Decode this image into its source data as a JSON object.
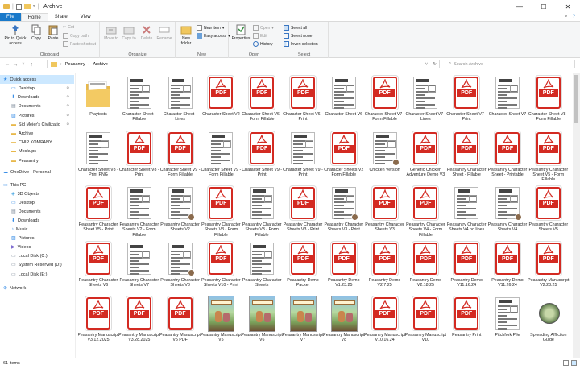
{
  "window": {
    "title": "Archive",
    "controls": {
      "minimize": "—",
      "maximize": "☐",
      "close": "✕"
    }
  },
  "tabs": [
    {
      "label": "File",
      "kind": "file"
    },
    {
      "label": "Home",
      "kind": "active"
    },
    {
      "label": "Share",
      "kind": ""
    },
    {
      "label": "View",
      "kind": ""
    }
  ],
  "ribbon": {
    "clipboard": {
      "label": "Clipboard",
      "pin": "Pin to Quick access",
      "copy": "Copy",
      "paste": "Paste",
      "cut": "Cut",
      "copy_path": "Copy path",
      "paste_shortcut": "Paste shortcut"
    },
    "organize": {
      "label": "Organize",
      "move_to": "Move to",
      "copy_to": "Copy to",
      "delete": "Delete",
      "rename": "Rename"
    },
    "new": {
      "label": "New",
      "new_folder": "New folder",
      "new_item": "New item",
      "easy_access": "Easy access"
    },
    "open": {
      "label": "Open",
      "properties": "Properties",
      "open": "Open",
      "edit": "Edit",
      "history": "History"
    },
    "select": {
      "label": "Select",
      "select_all": "Select all",
      "select_none": "Select none",
      "invert": "Invert selection"
    }
  },
  "address": {
    "crumbs": [
      "Peasantry",
      "Archive"
    ],
    "search_placeholder": "Search Archive"
  },
  "nav": {
    "items": [
      {
        "label": "Quick access",
        "icon": "star-icon",
        "level": 0,
        "pinned": false,
        "selected": true
      },
      {
        "label": "Desktop",
        "icon": "desktop-icon",
        "level": 1,
        "pinned": true,
        "selected": false
      },
      {
        "label": "Downloads",
        "icon": "download-icon",
        "level": 1,
        "pinned": true,
        "selected": false
      },
      {
        "label": "Documents",
        "icon": "documents-icon",
        "level": 1,
        "pinned": true,
        "selected": false
      },
      {
        "label": "Pictures",
        "icon": "pictures-icon",
        "level": 1,
        "pinned": true,
        "selected": false
      },
      {
        "label": "Sid Meier's Civilizatio",
        "icon": "folder-icon",
        "level": 1,
        "pinned": true,
        "selected": false
      },
      {
        "label": "Archive",
        "icon": "folder-icon",
        "level": 1,
        "pinned": false,
        "selected": false
      },
      {
        "label": "CHIP KOMPANY",
        "icon": "folder-icon",
        "level": 1,
        "pinned": false,
        "selected": false
      },
      {
        "label": "Mockups",
        "icon": "folder-icon",
        "level": 1,
        "pinned": false,
        "selected": false
      },
      {
        "label": "Peasantry",
        "icon": "folder-icon",
        "level": 1,
        "pinned": false,
        "selected": false
      },
      {
        "label": "OneDrive - Personal",
        "icon": "cloud-icon",
        "level": 0,
        "pinned": false,
        "selected": false
      },
      {
        "label": "This PC",
        "icon": "pc-icon",
        "level": 0,
        "pinned": false,
        "selected": false
      },
      {
        "label": "3D Objects",
        "icon": "cube-icon",
        "level": 1,
        "pinned": false,
        "selected": false
      },
      {
        "label": "Desktop",
        "icon": "desktop-icon",
        "level": 1,
        "pinned": false,
        "selected": false
      },
      {
        "label": "Documents",
        "icon": "documents-icon",
        "level": 1,
        "pinned": false,
        "selected": false
      },
      {
        "label": "Downloads",
        "icon": "download-icon",
        "level": 1,
        "pinned": false,
        "selected": false
      },
      {
        "label": "Music",
        "icon": "music-icon",
        "level": 1,
        "pinned": false,
        "selected": false
      },
      {
        "label": "Pictures",
        "icon": "pictures-icon",
        "level": 1,
        "pinned": false,
        "selected": false
      },
      {
        "label": "Videos",
        "icon": "video-icon",
        "level": 1,
        "pinned": false,
        "selected": false
      },
      {
        "label": "Local Disk (C:)",
        "icon": "drive-icon",
        "level": 1,
        "pinned": false,
        "selected": false
      },
      {
        "label": "System Reserved (D:)",
        "icon": "drive-icon",
        "level": 1,
        "pinned": false,
        "selected": false
      },
      {
        "label": "Local Disk (E:)",
        "icon": "drive-icon",
        "level": 1,
        "pinned": false,
        "selected": false
      },
      {
        "label": "Network",
        "icon": "network-icon",
        "level": 0,
        "pinned": false,
        "selected": false
      }
    ]
  },
  "files": [
    {
      "name": "Playtests",
      "type": "folder"
    },
    {
      "name": "Character Sheet - Fillable",
      "type": "sheet"
    },
    {
      "name": "Character Sheet - Lines",
      "type": "sheet"
    },
    {
      "name": "Character Sheet V2",
      "type": "pdf"
    },
    {
      "name": "Character Sheet V6 - Form Fillable",
      "type": "pdf"
    },
    {
      "name": "Character Sheet V6 - Print",
      "type": "pdf"
    },
    {
      "name": "Character Sheet V6",
      "type": "sheet"
    },
    {
      "name": "Character Sheet V7 - Form Fillable",
      "type": "pdf"
    },
    {
      "name": "Character Sheet V7 - Lines",
      "type": "sheet"
    },
    {
      "name": "Character Sheet V7 - Print",
      "type": "pdf"
    },
    {
      "name": "Character Sheet V7",
      "type": "sheet"
    },
    {
      "name": "Character Sheet V8 - Form Fillable",
      "type": "pdf"
    },
    {
      "name": "Character Sheet V8 - Print PNG",
      "type": "sheet"
    },
    {
      "name": "Character Sheet V8 - Print",
      "type": "pdf"
    },
    {
      "name": "Character Sheet V9 - Form Fillable",
      "type": "pdf"
    },
    {
      "name": "Character Sheet V9 - Form Fillable",
      "type": "sheet"
    },
    {
      "name": "Character Sheet V9 - Print",
      "type": "pdf"
    },
    {
      "name": "Character Sheet V9 - Print",
      "type": "sheet"
    },
    {
      "name": "Character Sheets V2 Form Fillable",
      "type": "pdf"
    },
    {
      "name": "Chicken Version",
      "type": "sheetav"
    },
    {
      "name": "Generic Chicken Adventure Demo V3",
      "type": "pdf"
    },
    {
      "name": "Peasantry Character Sheet - Fillable",
      "type": "pdf"
    },
    {
      "name": "Peasantry Character Sheet - Printable",
      "type": "pdf"
    },
    {
      "name": "Peasantry Character Sheet V5 - Form Fillable",
      "type": "pdf"
    },
    {
      "name": "Peasantry Character Sheet V5 - Print",
      "type": "pdf"
    },
    {
      "name": "Peasantry Character Sheets V2 - Form Fillable",
      "type": "sheet"
    },
    {
      "name": "Peasantry Character Sheets V2",
      "type": "sheetav"
    },
    {
      "name": "Peasantry Character Sheets V3 - Form Fillable",
      "type": "pdf"
    },
    {
      "name": "Peasantry Character Sheets V3 - Form Fillable",
      "type": "sheet"
    },
    {
      "name": "Peasantry Character Sheets V3 - Print",
      "type": "pdf"
    },
    {
      "name": "Peasantry Character Sheets V3 - Print",
      "type": "sheetav"
    },
    {
      "name": "Peasantry Character Sheets V3",
      "type": "pdf"
    },
    {
      "name": "Peasantry Character Sheets V4 - Form Fillable",
      "type": "pdf"
    },
    {
      "name": "Peasantry Character Sheets V4 no lines",
      "type": "sheet"
    },
    {
      "name": "Peasantry Character Sheets V4",
      "type": "sheetav"
    },
    {
      "name": "Peasantry Character Sheets V5",
      "type": "pdf"
    },
    {
      "name": "Peasantry Character Sheets V6",
      "type": "pdf"
    },
    {
      "name": "Peasantry Character Sheets V7",
      "type": "sheet"
    },
    {
      "name": "Peasantry Character Sheets V8",
      "type": "sheetav"
    },
    {
      "name": "Peasantry Character Sheets V10 - Print",
      "type": "pdf"
    },
    {
      "name": "Peasantry Character Sheets",
      "type": "sheet"
    },
    {
      "name": "Peasantry Demo Packet",
      "type": "pdf"
    },
    {
      "name": "Peasantry Demo V1.23.25",
      "type": "pdf"
    },
    {
      "name": "Peasantry Demo V2.7.25",
      "type": "pdf"
    },
    {
      "name": "Peasantry Demo V2.18.25",
      "type": "pdf"
    },
    {
      "name": "Peasantry Demo V11.16.24",
      "type": "pdf"
    },
    {
      "name": "Peasantry Demo V11.26.24",
      "type": "pdf"
    },
    {
      "name": "Peasantry Manuscript V2.23.25",
      "type": "pdf"
    },
    {
      "name": "Peasantry Manuscript V3.12.2025",
      "type": "pdf"
    },
    {
      "name": "Peasantry Manuscript V3.28.2025",
      "type": "pdf"
    },
    {
      "name": "Peasantry Manuscript V5 PDF",
      "type": "pdf"
    },
    {
      "name": "Peasantry Manuscript V5",
      "type": "cover"
    },
    {
      "name": "Peasantry Manuscript V6",
      "type": "cover"
    },
    {
      "name": "Peasantry Manuscript V7",
      "type": "cover"
    },
    {
      "name": "Peasantry Manuscript V8",
      "type": "cover"
    },
    {
      "name": "Peasantry Manuscript V10.16.24",
      "type": "pdf"
    },
    {
      "name": "Peasantry Manuscript V10",
      "type": "pdf"
    },
    {
      "name": "Peasantry Print",
      "type": "pdf"
    },
    {
      "name": "Pitchfork Pile",
      "type": "sheet"
    },
    {
      "name": "Spreading Affliction Guide",
      "type": "roundel"
    }
  ],
  "status": {
    "count": "61 items"
  },
  "colors": {
    "accent": "#1979ca",
    "pdf_red": "#d32a22",
    "selection": "#cce8ff"
  }
}
